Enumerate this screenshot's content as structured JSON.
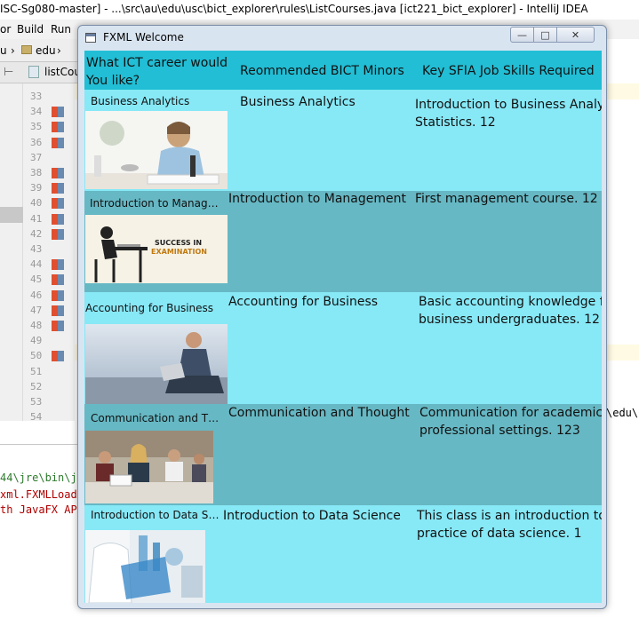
{
  "ide": {
    "window_title": "ISC-Sg080-master] - ...\\src\\au\\edu\\usc\\bict_explorer\\rules\\ListCourses.java [ict221_bict_explorer] - IntelliJ IDEA",
    "menu": [
      "or",
      "Build",
      "Run"
    ],
    "nav_crumbs": [
      "u",
      "edu"
    ],
    "open_tab": "listCou",
    "line_numbers": [
      "33",
      "34",
      "35",
      "36",
      "37",
      "38",
      "39",
      "40",
      "41",
      "42",
      "43",
      "44",
      "45",
      "46",
      "47",
      "48",
      "49",
      "50",
      "51",
      "52",
      "53",
      "54"
    ],
    "path_fragment": "\\edu\\",
    "console": [
      "44\\jre\\bin\\ja",
      "xml.FXMLLoad",
      "th JavaFX AP"
    ]
  },
  "window": {
    "title": "FXML Welcome",
    "controls": {
      "minimize": "—",
      "maximize": "□",
      "close": "✕"
    }
  },
  "table": {
    "headers": {
      "career": "What ICT career would You like?",
      "minors": "Reommended BICT Minors",
      "skills": "Key SFIA Job Skills Required"
    },
    "rows": [
      {
        "career": "Business Analytics",
        "minor": "Business Analytics",
        "skills": [
          "Introduction to Business Analytics",
          "Statistics. 12"
        ],
        "image": "student-studying-photo"
      },
      {
        "career": "Introduction to Managem…",
        "minor": "Introduction to Management",
        "skills": [
          "First management course.       12"
        ],
        "image": "success-in-examination-graphic",
        "image_text": "SUCCESS IN EXAMINATION"
      },
      {
        "career": "Accounting for Business",
        "minor": "Accounting for Business",
        "skills": [
          "Basic accounting knowledge for",
          "business undergraduates.       12"
        ],
        "image": "man-with-laptop-photo"
      },
      {
        "career": "Communication and Thou…",
        "minor": "Communication and Thought",
        "skills": [
          "Communication for academic and",
          "professional settings.       123"
        ],
        "image": "classroom-students-photo"
      },
      {
        "career": "Introduction to Data Scie…",
        "minor": "Introduction to Data Science",
        "skills": [
          "This class is an introduction to the",
          "practice of data science. 1"
        ],
        "image": "medical-data-photo"
      }
    ]
  }
}
